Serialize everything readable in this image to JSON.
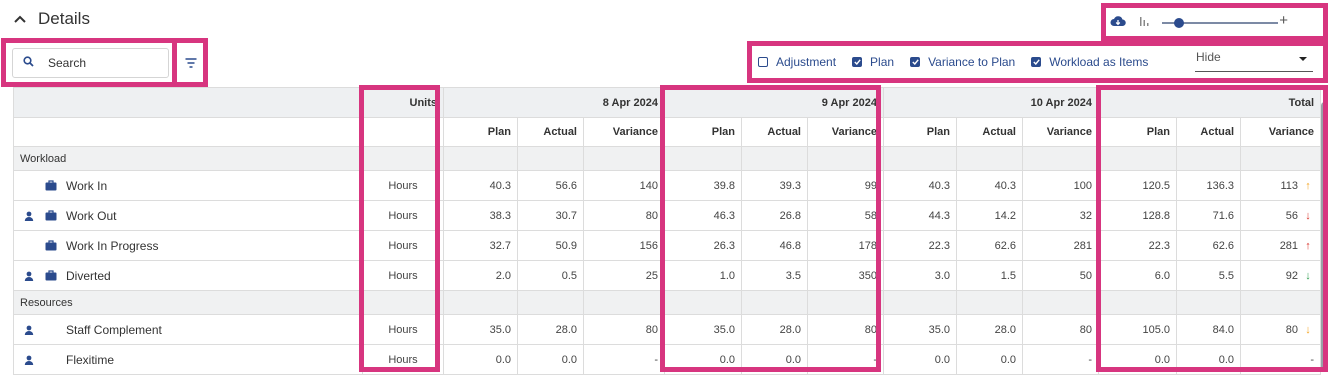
{
  "section": {
    "title": "Details"
  },
  "search": {
    "placeholder": "Search"
  },
  "options": [
    {
      "label": "Adjustment",
      "checked": false
    },
    {
      "label": "Plan",
      "checked": true
    },
    {
      "label": "Variance to Plan",
      "checked": true
    },
    {
      "label": "Workload as Items",
      "checked": true
    }
  ],
  "hide_select": {
    "value": "Hide"
  },
  "zoom": {
    "level": 0.1
  },
  "table": {
    "units_header": "Units",
    "dates": [
      "8 Apr 2024",
      "9 Apr 2024",
      "10 Apr 2024"
    ],
    "total_header": "Total",
    "subheaders": [
      "Plan",
      "Actual",
      "Variance"
    ],
    "groups": [
      {
        "name": "Workload",
        "rows": [
          {
            "name": "Work In",
            "user": false,
            "case": true,
            "units": "Hours",
            "d1": [
              "40.3",
              "56.6",
              "140"
            ],
            "d2": [
              "39.8",
              "39.3",
              "99"
            ],
            "d3": [
              "40.3",
              "40.3",
              "100"
            ],
            "total": [
              "120.5",
              "136.3",
              "113"
            ],
            "arrow": "↑",
            "arrow_color": "#f5a623"
          },
          {
            "name": "Work Out",
            "user": true,
            "case": true,
            "units": "Hours",
            "d1": [
              "38.3",
              "30.7",
              "80"
            ],
            "d2": [
              "46.3",
              "26.8",
              "58"
            ],
            "d3": [
              "44.3",
              "14.2",
              "32"
            ],
            "total": [
              "128.8",
              "71.6",
              "56"
            ],
            "arrow": "↓",
            "arrow_color": "#d9342b"
          },
          {
            "name": "Work In Progress",
            "user": false,
            "case": true,
            "units": "Hours",
            "d1": [
              "32.7",
              "50.9",
              "156"
            ],
            "d2": [
              "26.3",
              "46.8",
              "178"
            ],
            "d3": [
              "22.3",
              "62.6",
              "281"
            ],
            "total": [
              "22.3",
              "62.6",
              "281"
            ],
            "arrow": "↑",
            "arrow_color": "#d9342b"
          },
          {
            "name": "Diverted",
            "user": true,
            "case": true,
            "units": "Hours",
            "d1": [
              "2.0",
              "0.5",
              "25"
            ],
            "d2": [
              "1.0",
              "3.5",
              "350"
            ],
            "d3": [
              "3.0",
              "1.5",
              "50"
            ],
            "total": [
              "6.0",
              "5.5",
              "92"
            ],
            "arrow": "↓",
            "arrow_color": "#2e9e4f"
          }
        ]
      },
      {
        "name": "Resources",
        "rows": [
          {
            "name": "Staff Complement",
            "user": true,
            "case": false,
            "units": "Hours",
            "d1": [
              "35.0",
              "28.0",
              "80"
            ],
            "d2": [
              "35.0",
              "28.0",
              "80"
            ],
            "d3": [
              "35.0",
              "28.0",
              "80"
            ],
            "total": [
              "105.0",
              "84.0",
              "80"
            ],
            "arrow": "↓",
            "arrow_color": "#f5a623"
          },
          {
            "name": "Flexitime",
            "user": true,
            "case": false,
            "units": "Hours",
            "d1": [
              "0.0",
              "0.0",
              "-"
            ],
            "d2": [
              "0.0",
              "0.0",
              "-"
            ],
            "d3": [
              "0.0",
              "0.0",
              "-"
            ],
            "total": [
              "0.0",
              "0.0",
              "-"
            ],
            "arrow": "",
            "arrow_color": ""
          }
        ]
      }
    ]
  },
  "colors": {
    "accent": "#2b4b8d",
    "highlight": "#d7357f",
    "header_bg": "#eef0f2"
  },
  "icons": [
    "chevron-up-icon",
    "cloud-download-icon",
    "bar-chart-icon",
    "search-icon",
    "filter-icon",
    "user-icon",
    "briefcase-icon"
  ]
}
